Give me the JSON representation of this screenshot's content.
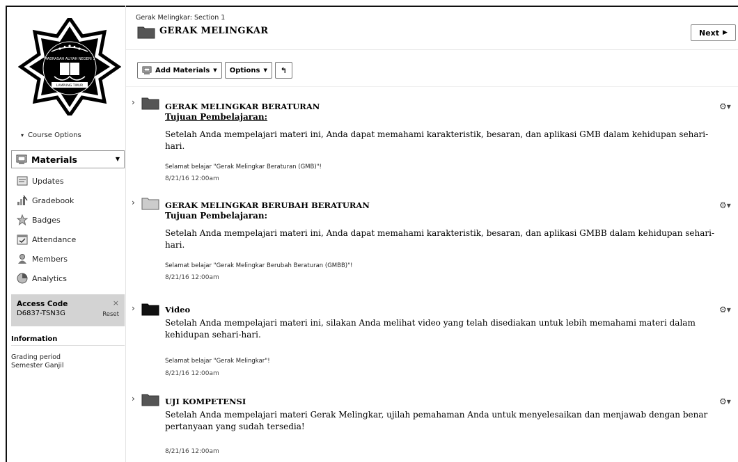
{
  "logo": {
    "text_top": "MADRASAH ALIYAH NEGERI 1",
    "text_bottom": "LAMPUNG TIMUR"
  },
  "sidebar": {
    "course_options": "Course Options",
    "materials": "Materials",
    "items": [
      {
        "label": "Updates",
        "icon": "updates-icon"
      },
      {
        "label": "Gradebook",
        "icon": "gradebook-icon"
      },
      {
        "label": "Badges",
        "icon": "badges-icon"
      },
      {
        "label": "Attendance",
        "icon": "attendance-icon"
      },
      {
        "label": "Members",
        "icon": "members-icon"
      },
      {
        "label": "Analytics",
        "icon": "analytics-icon"
      }
    ],
    "access": {
      "title": "Access Code",
      "code": "D6837-TSN3G",
      "close": "×",
      "reset": "Reset"
    },
    "information": {
      "title": "Information",
      "line1": "Grading period",
      "line2": "Semester Ganjil"
    }
  },
  "header": {
    "breadcrumb": "Gerak Melingkar: Section 1",
    "title": "GERAK MELINGKAR",
    "next": "Next"
  },
  "toolbar": {
    "add_materials": "Add Materials",
    "options": "Options"
  },
  "items": [
    {
      "title": "GERAK MELINGKAR BERATURAN",
      "subtitle": "Tujuan Pembelajaran:",
      "desc": "Setelah Anda mempelajari materi ini, Anda dapat  memahami karakteristik, besaran, dan aplikasi GMB dalam kehidupan sehari-hari.",
      "note": "Selamat belajar \"Gerak Melingkar Beraturan (GMB)\"!",
      "date": "8/21/16 12:00am",
      "folder_color": "#555555"
    },
    {
      "title": "GERAK MELINGKAR BERUBAH BERATURAN",
      "subtitle": "Tujuan Pembelajaran:",
      "desc": "Setelah Anda mempelajari materi ini, Anda dapat  memahami karakteristik, besaran, dan aplikasi GMBB dalam kehidupan sehari-hari.",
      "note": "Selamat belajar \"Gerak Melingkar Berubah Beraturan (GMBB)\"!",
      "date": "8/21/16 12:00am",
      "folder_color": "#cccccc"
    },
    {
      "title": "Video",
      "desc": "Setelah Anda mempelajari materi ini, silakan Anda melihat video yang telah disediakan untuk lebih memahami materi dalam kehidupan sehari-hari.",
      "note": "Selamat belajar \"Gerak Melingkar\"!",
      "date": "8/21/16 12:00am",
      "folder_color": "#111111"
    },
    {
      "title": "UJI KOMPETENSI",
      "desc": "Setelah Anda mempelajari materi Gerak Melingkar, ujilah pemahaman Anda untuk menyelesaikan dan menjawab dengan benar pertanyaan yang sudah tersedia!",
      "date": "8/21/16 12:00am",
      "folder_color": "#555555"
    }
  ]
}
